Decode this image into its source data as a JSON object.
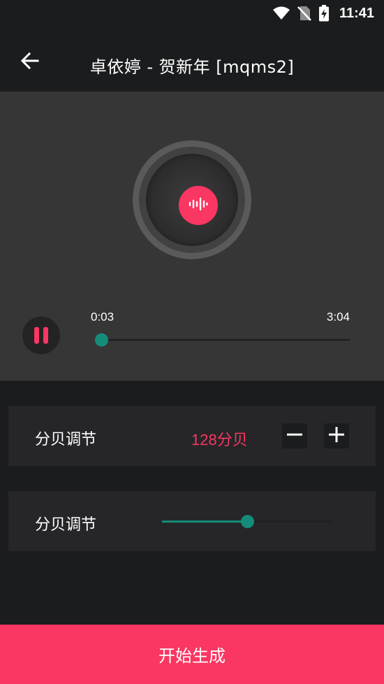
{
  "status_bar": {
    "time": "11:41",
    "icons": [
      "wifi-icon",
      "no-sim-icon",
      "battery-charging-icon"
    ]
  },
  "app_bar": {
    "title": "卓依婷 - 贺新年 [mqms2]",
    "back_icon": "arrow-left-icon"
  },
  "player": {
    "state": "playing",
    "current_time": "0:03",
    "total_time": "3:04",
    "progress": 0.016,
    "center_icon": "audio-wave-icon"
  },
  "decibel_card": {
    "label": "分贝调节",
    "value": "128分贝",
    "minus_icon": "minus-icon",
    "plus_icon": "plus-icon"
  },
  "slider_card": {
    "label": "分贝调节",
    "value": 0.5
  },
  "generate_button": {
    "label": "开始生成"
  },
  "colors": {
    "accent": "#fa3662",
    "slider": "#138c79",
    "background": "#1b1c1e",
    "player_bg": "#363637",
    "card_bg": "#262629"
  }
}
